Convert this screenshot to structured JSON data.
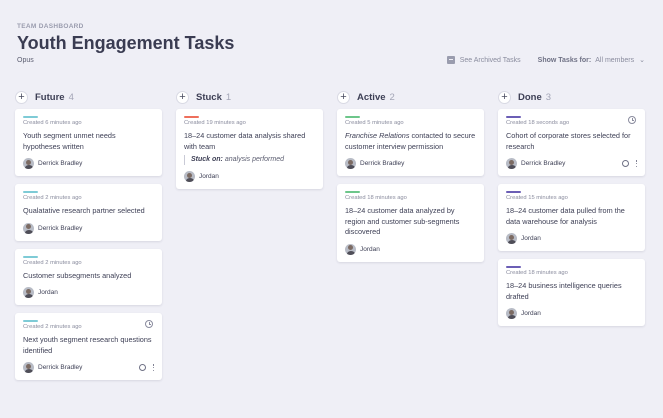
{
  "header": {
    "eyebrow": "TEAM DASHBOARD",
    "title": "Youth Engagement Tasks",
    "org": "Opus"
  },
  "toolbar": {
    "archived_label": "See Archived Tasks",
    "show_label": "Show Tasks for:",
    "show_value": "All members"
  },
  "icons": {
    "add": "plus-icon",
    "archive": "archive-icon",
    "clock": "clock-icon",
    "github": "github-icon",
    "more": "more-vertical-icon"
  },
  "colors": {
    "future": "#7ecbd6",
    "stuck": "#ee6f5c",
    "active": "#6dc68a",
    "done": "#6b5eb5"
  },
  "columns": [
    {
      "name": "Future",
      "count": "4",
      "cards": [
        {
          "created": "Created 6 minutes ago",
          "title": "Youth segment unmet needs hypotheses written",
          "owner": "Derrick Bradley"
        },
        {
          "created": "Created 2 minutes ago",
          "title": "Qualatative research partner selected",
          "owner": "Derrick Bradley"
        },
        {
          "created": "Created 2 minutes ago",
          "title": "Customer subsegments analyzed",
          "owner": "Jordan"
        },
        {
          "created": "Created 2 minutes ago",
          "title": "Next youth segment research questions identified",
          "owner": "Derrick Bradley"
        }
      ]
    },
    {
      "name": "Stuck",
      "count": "1",
      "cards": [
        {
          "created": "Created 19 minutes ago",
          "title": "18–24 customer data analysis shared with team",
          "stuck_label": "Stuck on:",
          "stuck_text": "analysis performed",
          "owner": "Jordan"
        }
      ]
    },
    {
      "name": "Active",
      "count": "2",
      "cards": [
        {
          "created": "Created 5 minutes ago",
          "title_em": "Franchise Relations",
          "title_rest": " contacted to secure customer interview permission",
          "owner": "Derrick Bradley"
        },
        {
          "created": "Created 18 minutes ago",
          "title": "18–24 customer data analyzed by region and customer sub-segments discovered",
          "owner": "Jordan"
        }
      ]
    },
    {
      "name": "Done",
      "count": "3",
      "cards": [
        {
          "created": "Created 18 seconds ago",
          "title": "Cohort of corporate stores selected for research",
          "owner": "Derrick Bradley"
        },
        {
          "created": "Created 15 minutes ago",
          "title": "18–24 customer data pulled from the data warehouse for analysis",
          "owner": "Jordan"
        },
        {
          "created": "Created 18 minutes ago",
          "title": "18–24 business intelligence queries drafted",
          "owner": "Jordan"
        }
      ]
    }
  ]
}
